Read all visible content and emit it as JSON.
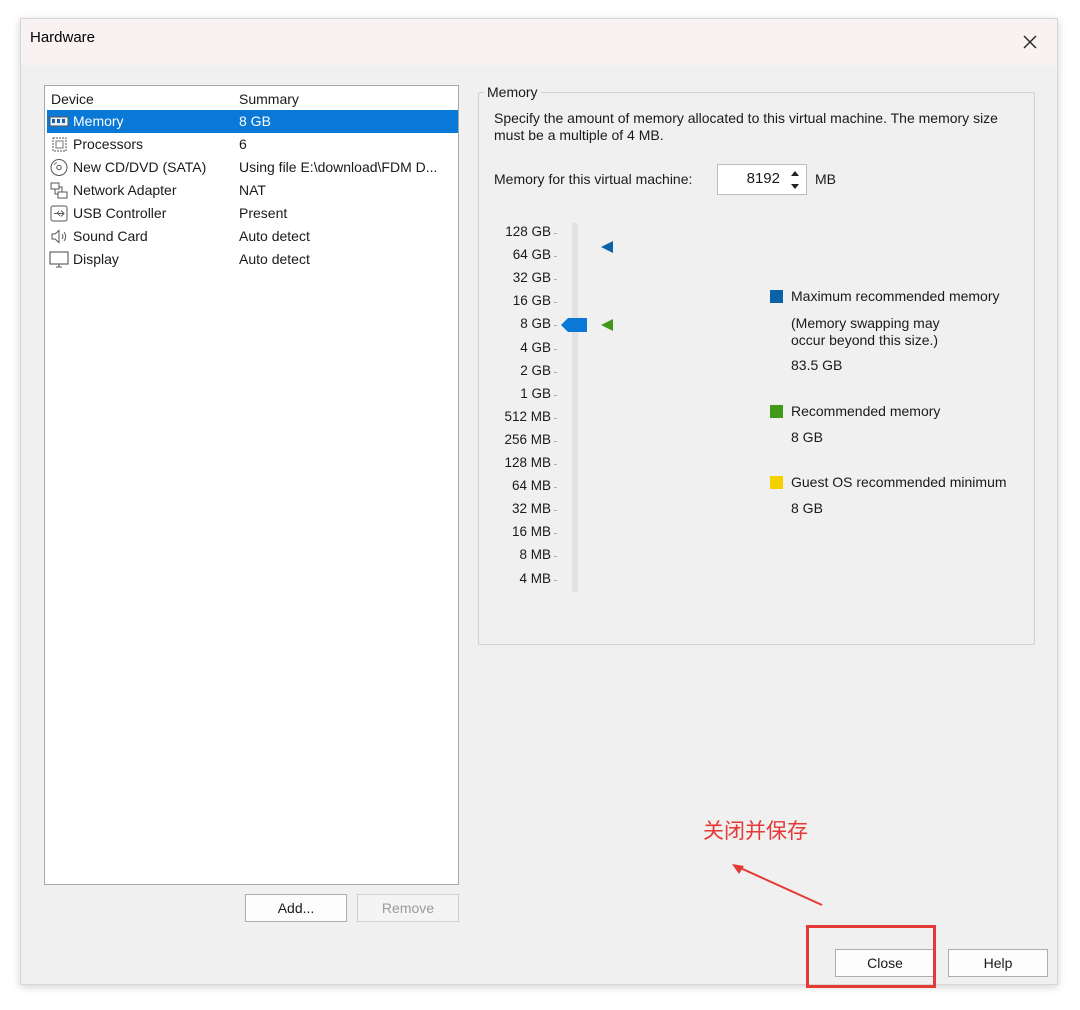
{
  "window": {
    "title": "Hardware"
  },
  "devices": {
    "col_device": "Device",
    "col_summary": "Summary",
    "items": [
      {
        "name": "Memory",
        "summary": "8 GB",
        "icon": "memory-icon"
      },
      {
        "name": "Processors",
        "summary": "6",
        "icon": "processor-icon"
      },
      {
        "name": "New CD/DVD (SATA)",
        "summary": "Using file E:\\download\\FDM D...",
        "icon": "cd-dvd-icon"
      },
      {
        "name": "Network Adapter",
        "summary": "NAT",
        "icon": "network-icon"
      },
      {
        "name": "USB Controller",
        "summary": "Present",
        "icon": "usb-icon"
      },
      {
        "name": "Sound Card",
        "summary": "Auto detect",
        "icon": "speaker-icon"
      },
      {
        "name": "Display",
        "summary": "Auto detect",
        "icon": "monitor-icon"
      }
    ],
    "add_label": "Add...",
    "remove_label": "Remove"
  },
  "memory": {
    "group_title": "Memory",
    "description": "Specify the amount of memory allocated to this virtual machine. The memory size must be a multiple of 4 MB.",
    "field_label": "Memory for this virtual machine:",
    "value": "8192",
    "unit": "MB",
    "scale": [
      "128 GB",
      "64 GB",
      "32 GB",
      "16 GB",
      "8 GB",
      "4 GB",
      "2 GB",
      "1 GB",
      "512 MB",
      "256 MB",
      "128 MB",
      "64 MB",
      "32 MB",
      "16 MB",
      "8 MB",
      "4 MB"
    ],
    "slider_value": "8 GB",
    "max_recommended_marker": "64 GB",
    "recommended_marker": "8 GB",
    "legend": {
      "max_title": "Maximum recommended memory",
      "max_note_1": "(Memory swapping may",
      "max_note_2": "occur beyond this size.)",
      "max_value": "83.5 GB",
      "rec_title": "Recommended memory",
      "rec_value": "8 GB",
      "guest_title": "Guest OS recommended minimum",
      "guest_value": "8 GB"
    },
    "colors": {
      "max": "#0b62a8",
      "recommended": "#3f9a1a",
      "guest": "#f5d000",
      "selection": "#0a78d7"
    }
  },
  "footer": {
    "close_label": "Close",
    "help_label": "Help"
  },
  "annotation": {
    "text": "关闭并保存"
  }
}
